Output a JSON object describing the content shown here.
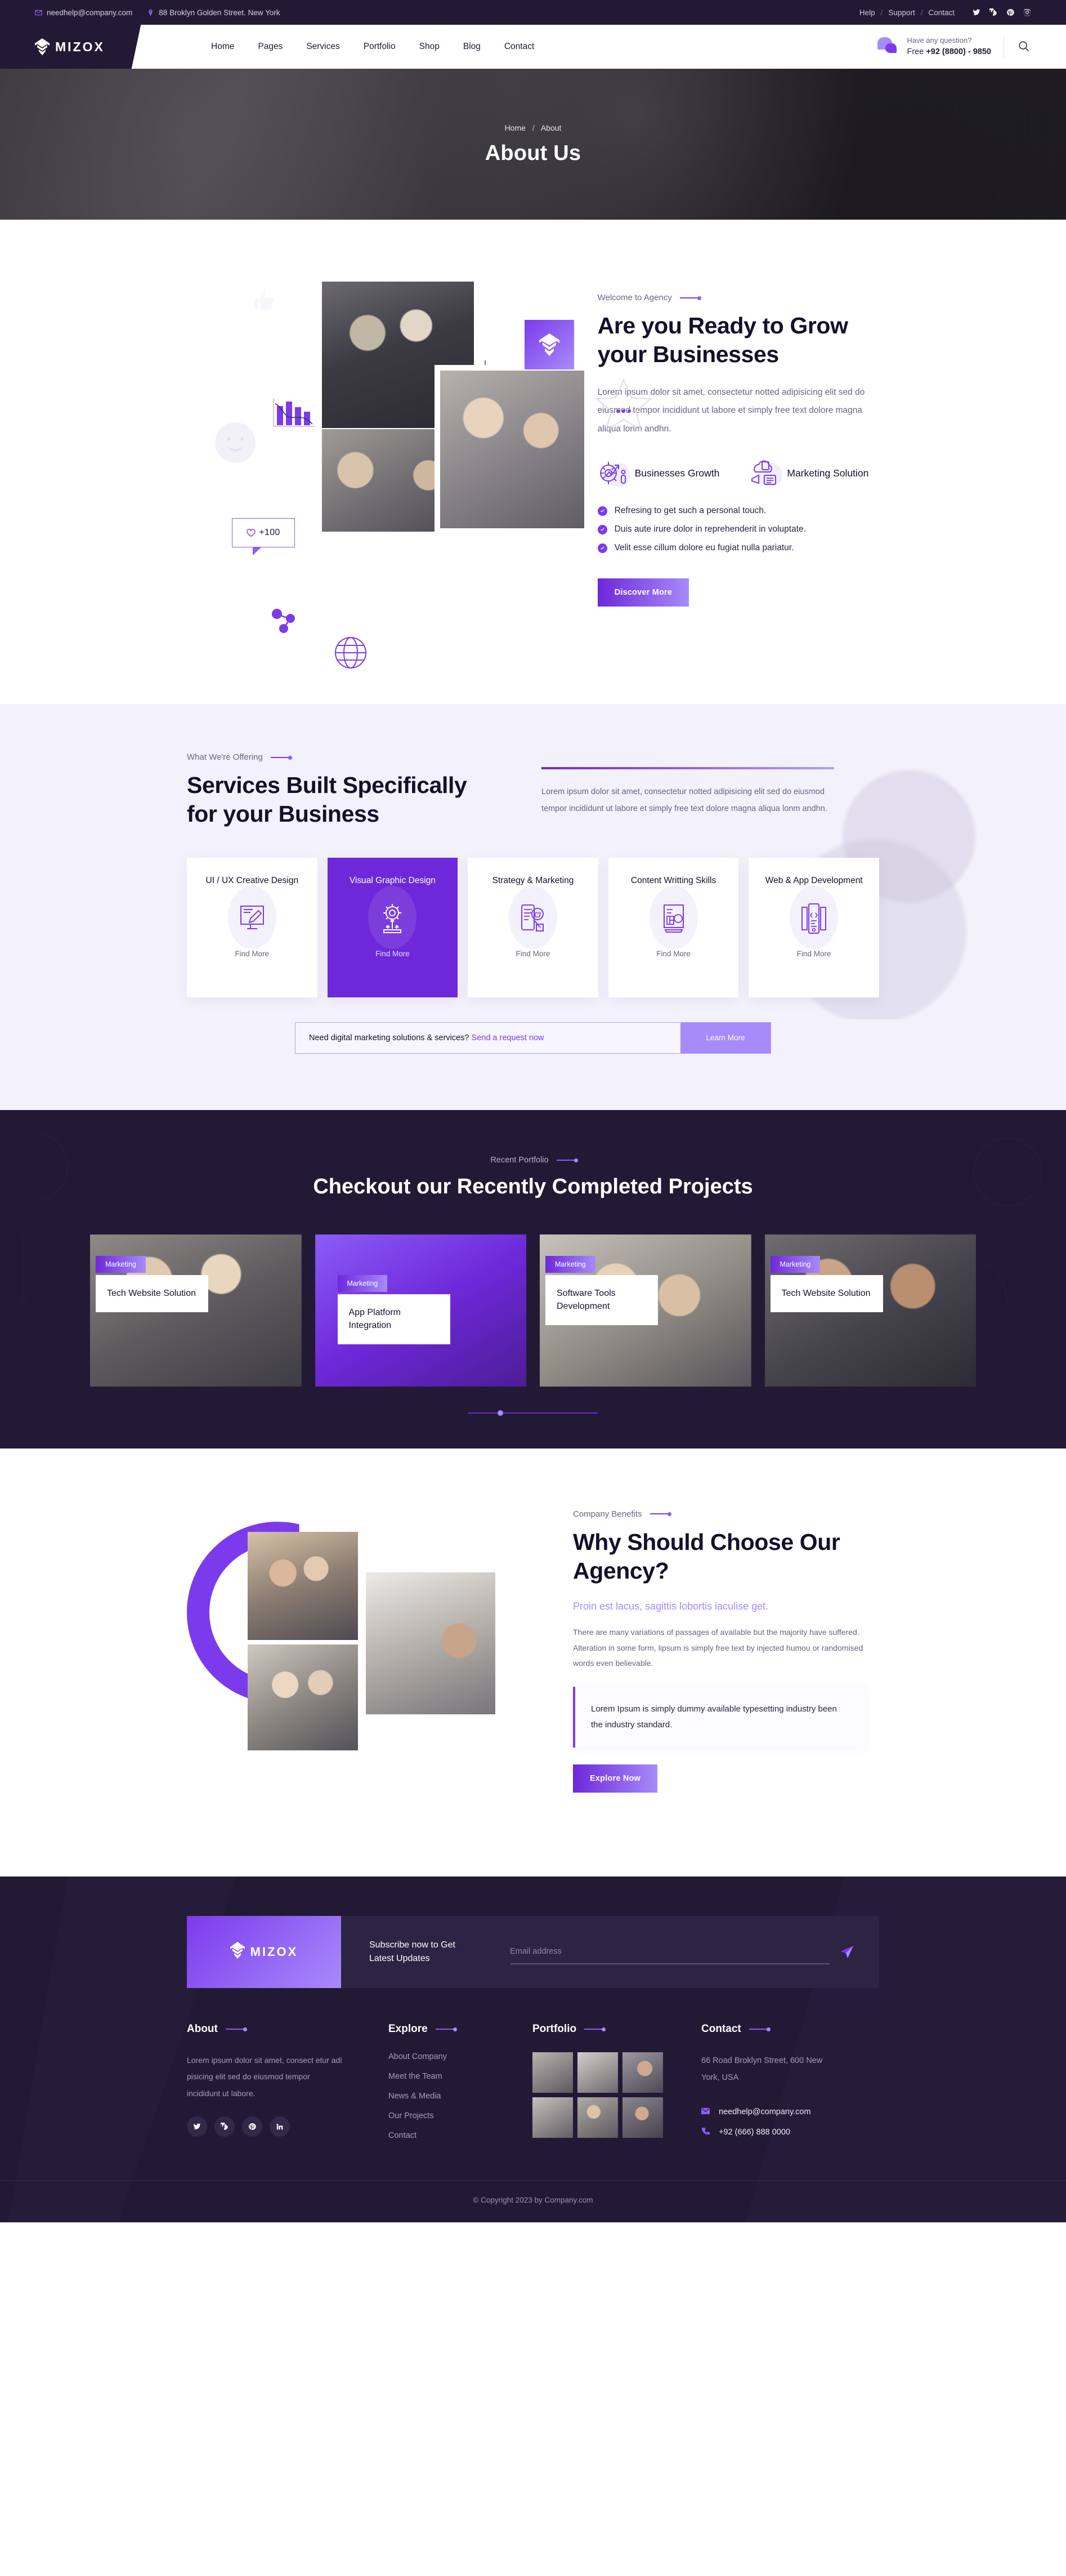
{
  "topbar": {
    "email": "needhelp@company.com",
    "address": "88 Broklyn Golden Street. New York",
    "links": [
      "Help",
      "Support",
      "Contact"
    ],
    "socials": [
      "twitter-icon",
      "facebook-icon",
      "pinterest-icon",
      "instagram-icon"
    ]
  },
  "header": {
    "brand": "MIZOX",
    "nav": [
      "Home",
      "Pages",
      "Services",
      "Portfolio",
      "Shop",
      "Blog",
      "Contact"
    ],
    "question_label": "Have any question?",
    "phone_prefix": "Free ",
    "phone": "+92 (8800) - 9850"
  },
  "pagehero": {
    "crumb_home": "Home",
    "crumb_sep": "/",
    "crumb_current": "About",
    "title": "About Us"
  },
  "grow": {
    "eyebrow": "Welcome to Agency",
    "title": "Are you Ready to Grow your Businesses",
    "paragraph": "Lorem ipsum dolor sit amet, consectetur notted adipisicing elit sed do eiusmod tempor incididunt ut labore et simply free text dolore magna aliqua lonm andhn.",
    "features": [
      {
        "label": "Businesses Growth",
        "icon": "growth-gear-icon"
      },
      {
        "label": "Marketing Solution",
        "icon": "megaphone-cloud-icon"
      }
    ],
    "checks": [
      "Refresing to get such a personal touch.",
      "Duis aute irure dolor in reprehenderit in voluptate.",
      "Velit esse cillum dolore eu fugiat nulla pariatur."
    ],
    "button": "Discover More",
    "deco_badge": "+100"
  },
  "services": {
    "eyebrow": "What We're Offering",
    "title": "Services Built Specifically for your Business",
    "paragraph": "Lorem ipsum dolor sit amet, consectetur notted adipisicing elit sed do eiusmod tempor incididunt ut labore et simply free text dolore magna aliqua lonm andhn.",
    "cards": [
      {
        "title": "UI / UX Creative Design",
        "icon": "pen-screen-icon",
        "more": "Find More",
        "active": false
      },
      {
        "title": "Visual Graphic Design",
        "icon": "gear-growth-icon",
        "more": "Find More",
        "active": true
      },
      {
        "title": "Strategy & Marketing",
        "icon": "cart-mobile-icon",
        "more": "Find More",
        "active": false
      },
      {
        "title": "Content Writting Skills",
        "icon": "document-pencil-icon",
        "more": "Find More",
        "active": false
      },
      {
        "title": "Web & App Development",
        "icon": "code-device-icon",
        "more": "Find More",
        "active": false
      }
    ],
    "cta_question": "Need digital marketing solutions & services? ",
    "cta_link": "Send a request now",
    "cta_button": "Learn More"
  },
  "portfolio": {
    "eyebrow": "Recent Portfolio",
    "title": "Checkout our Recently Completed Projects",
    "items": [
      {
        "tag": "Marketing",
        "name": "Tech Website Solution"
      },
      {
        "tag": "Marketing",
        "name": "App Platform Integration"
      },
      {
        "tag": "Marketing",
        "name": "Software Tools Development"
      },
      {
        "tag": "Marketing",
        "name": "Tech Website Solution"
      }
    ]
  },
  "why": {
    "eyebrow": "Company Benefits",
    "title": "Why Should Choose Our Agency?",
    "subtitle": "Proin est lacus, sagittis lobortis iaculise get.",
    "paragraph": "There are many variations of passages of available but the majority have suffered. Alteration in some form, lipsum is simply free text by injected humou or randomised words even believable.",
    "quote": "Lorem Ipsum is simply dummy available typesetting industry been the industry standard.",
    "button": "Explore Now"
  },
  "footer": {
    "newsletter": {
      "brand": "MIZOX",
      "headline": "Subscribe now to Get Latest Updates",
      "placeholder": "Email address",
      "send_icon": "send-icon"
    },
    "about": {
      "heading": "About",
      "text": "Lorem ipsum dolor sit amet, consect etur adi pisicing elit sed do eiusmod tempor incididunt ut labore.",
      "socials": [
        "twitter-icon",
        "facebook-icon",
        "pinterest-icon",
        "linkedin-icon"
      ]
    },
    "explore": {
      "heading": "Explore",
      "links": [
        "About Company",
        "Meet the Team",
        "News & Media",
        "Our Projects",
        "Contact"
      ]
    },
    "portfolio": {
      "heading": "Portfolio"
    },
    "contact": {
      "heading": "Contact",
      "address": "66 Road Broklyn Street, 600 New York, USA",
      "email": "needhelp@company.com",
      "phone": "+92 (666) 888 0000"
    },
    "copyright": "© Copyright 2023 by Company.com"
  },
  "colors": {
    "brand_purple": "#7c3aed",
    "light_purple": "#a78bfa",
    "dark": "#221a35",
    "services_bg": "#f3f1fb"
  }
}
